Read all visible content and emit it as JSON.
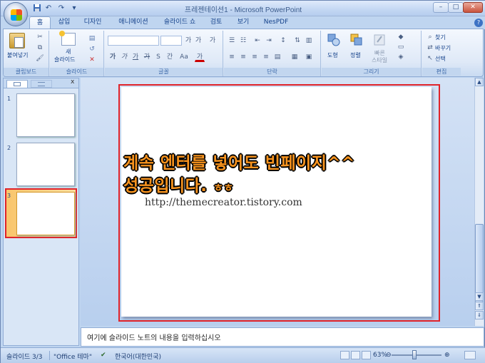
{
  "window": {
    "title": "프레젠테이션1 - Microsoft PowerPoint",
    "minimize_label": "–",
    "maximize_label": "□",
    "close_label": "✕"
  },
  "quick_access": {
    "save_icon": "save-icon",
    "undo_label": "↶",
    "redo_label": "↷",
    "customize_label": "▾"
  },
  "ribbon": {
    "tabs": [
      "홈",
      "삽입",
      "디자인",
      "애니메이션",
      "슬라이드 쇼",
      "검토",
      "보기",
      "NesPDF"
    ],
    "active_tab": "홈",
    "help_label": "?",
    "clipboard": {
      "paste_label": "붙여넣기",
      "group_label": "클립보드",
      "cut_label": "✂",
      "copy_label": "⧉",
      "format_label": "🖌"
    },
    "slides": {
      "new_slide_label": "새",
      "new_slide_label2": "슬라이드",
      "group_label": "슬라이드"
    },
    "font": {
      "group_label": "글꼴",
      "bold_label": "가",
      "italic_label": "가",
      "underline_label": "가",
      "strike_label": "가",
      "shadow_label": "S",
      "spacing_label": "간",
      "case_label": "Aa",
      "color_label": "가",
      "grow_label": "가",
      "shrink_label": "가",
      "clear_label": "가"
    },
    "paragraph": {
      "group_label": "단락"
    },
    "drawing": {
      "shapes_label": "도형",
      "arrange_label": "정렬",
      "quick_styles_label": "빠른",
      "quick_styles_label2": "스타일",
      "group_label": "그리기"
    },
    "editing": {
      "find_label": "찾기",
      "replace_label": "바꾸기",
      "select_label": "선택",
      "group_label": "편집"
    }
  },
  "slide_pane": {
    "tab_slides": "",
    "tab_outline": "",
    "close_label": "x",
    "thumbnails": [
      {
        "number": "1",
        "selected": false
      },
      {
        "number": "2",
        "selected": false
      },
      {
        "number": "3",
        "selected": true
      }
    ]
  },
  "slide": {
    "headline_line1": "계속 엔터를 넣어도 빈페이지^^",
    "headline_line2": "성공입니다.",
    "headline_suffix": "ㅎㅎ",
    "url": "http://themecreator.tistory.com",
    "headline_color": "#f7931e",
    "highlight_color": "#e0232a"
  },
  "notes": {
    "placeholder": "여기에 슬라이드 노트의 내용을 입력하십시오"
  },
  "status_bar": {
    "slide_indicator": "슬라이드 3/3",
    "theme": "\"Office 테마\"",
    "spell_icon": "spellcheck-icon",
    "language": "한국어(대한민국)",
    "zoom": "63%",
    "zoom_out_label": "⊖",
    "zoom_in_label": "⊕"
  }
}
